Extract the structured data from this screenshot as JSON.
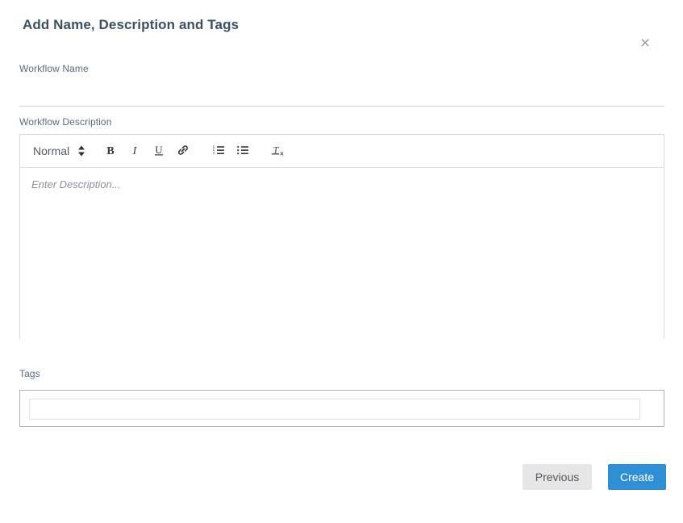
{
  "modal": {
    "title": "Add Name, Description and Tags",
    "close_icon": "close-icon",
    "close_label": "×"
  },
  "form": {
    "workflow_name": {
      "label": "Workflow Name",
      "value": "",
      "placeholder": ""
    },
    "workflow_description": {
      "label": "Workflow Description",
      "placeholder": "Enter Description...",
      "value": "",
      "toolbar": {
        "format_select": {
          "value": "Normal",
          "icon": "chevron-updown-icon"
        },
        "buttons": [
          {
            "name": "bold-button",
            "icon": "bold-icon",
            "label": "B"
          },
          {
            "name": "italic-button",
            "icon": "italic-icon",
            "label": "I"
          },
          {
            "name": "underline-button",
            "icon": "underline-icon",
            "label": "U"
          },
          {
            "name": "link-button",
            "icon": "link-icon",
            "label": ""
          },
          {
            "name": "ordered-list-button",
            "icon": "ordered-list-icon",
            "label": ""
          },
          {
            "name": "bullet-list-button",
            "icon": "bullet-list-icon",
            "label": ""
          },
          {
            "name": "clear-format-button",
            "icon": "clear-formatting-icon",
            "label": ""
          }
        ]
      }
    },
    "tags": {
      "label": "Tags",
      "value": "",
      "placeholder": ""
    }
  },
  "footer": {
    "previous_label": "Previous",
    "create_label": "Create"
  },
  "colors": {
    "primary": "#2f8fd5",
    "secondary": "#e6e6e6",
    "label_text": "#5c6b80",
    "title_text": "#3d4f61",
    "border": "#d5d8dc"
  }
}
